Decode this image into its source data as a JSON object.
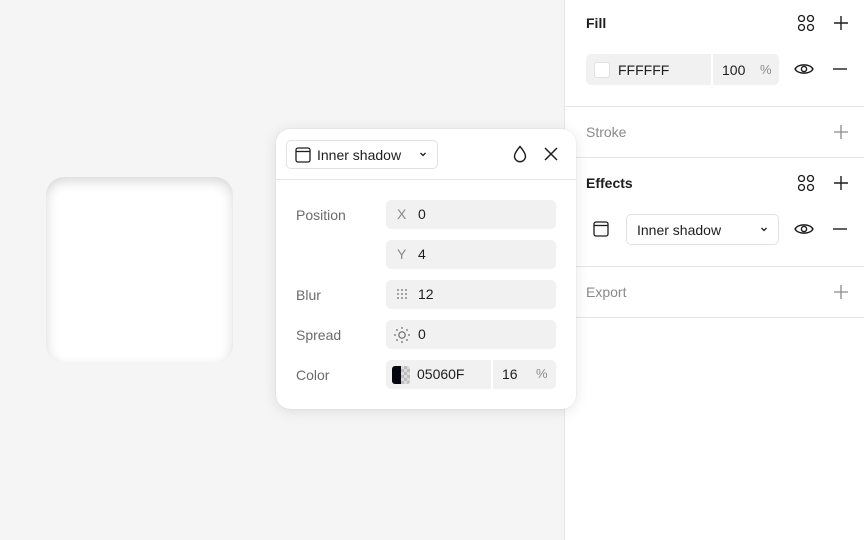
{
  "canvas": {
    "frame_fill": "#FFFFFF"
  },
  "panel": {
    "fill": {
      "title": "Fill",
      "hex": "FFFFFF",
      "opacity": "100",
      "percent": "%"
    },
    "stroke": {
      "title": "Stroke"
    },
    "effects": {
      "title": "Effects",
      "effect_type": "Inner shadow"
    },
    "export": {
      "title": "Export"
    }
  },
  "popup": {
    "effect_type": "Inner shadow",
    "position_label": "Position",
    "x_prefix": "X",
    "x_value": "0",
    "y_prefix": "Y",
    "y_value": "4",
    "blur_label": "Blur",
    "blur_value": "12",
    "spread_label": "Spread",
    "spread_value": "0",
    "color_label": "Color",
    "color_hex": "05060F",
    "color_opacity": "16",
    "percent": "%"
  },
  "colors": {
    "shadow_color": "#05060F",
    "panel_bg": "#FFFFFF",
    "canvas_bg": "#F5F5F5",
    "field_bg": "#F1F1F1"
  },
  "icons": [
    "styles-grid-icon",
    "plus-icon",
    "eye-icon",
    "minus-icon",
    "inner-shadow-icon",
    "chevron-down-icon",
    "drop-icon",
    "close-icon",
    "blur-dots-icon",
    "spread-sun-icon"
  ]
}
